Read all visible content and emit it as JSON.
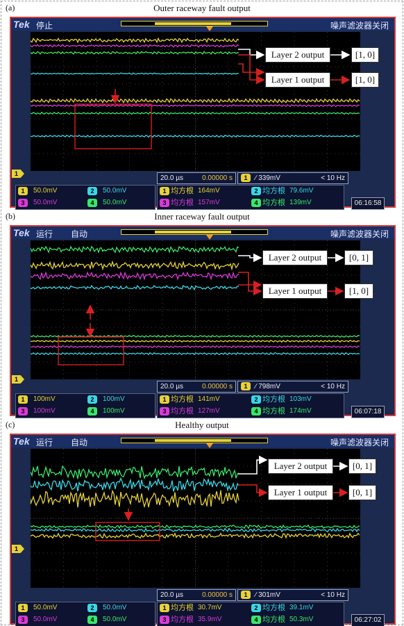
{
  "panels": [
    {
      "letter": "(a)",
      "title": "Outer raceway fault output",
      "scope": {
        "brand": "Tek",
        "run_state": "停止",
        "run_mode": "",
        "noise_filter": "噪声滤波器关闭",
        "timebase": "20.0 µs",
        "trigger_pos": "0.00000 s",
        "trigger_ch": "1",
        "trigger_level": "∕ 339mV",
        "trigger_freq": "< 10 Hz",
        "channels": [
          {
            "id": "1",
            "scale": "50.0mV",
            "color": "#e6d13a"
          },
          {
            "id": "2",
            "scale": "50.0mV",
            "color": "#3ad7e6"
          },
          {
            "id": "3",
            "scale": "50.0mV",
            "color": "#d83ad8"
          },
          {
            "id": "4",
            "scale": "50.0mV",
            "color": "#3ae66a"
          }
        ],
        "measurements": [
          {
            "id": "1",
            "label": "均方根",
            "value": "164mV",
            "color": "#e6d13a"
          },
          {
            "id": "2",
            "label": "均方根",
            "value": "79.6mV",
            "color": "#3ad7e6"
          },
          {
            "id": "3",
            "label": "均方根",
            "value": "157mV",
            "color": "#d83ad8"
          },
          {
            "id": "4",
            "label": "均方根",
            "value": "139mV",
            "color": "#3ae66a"
          }
        ],
        "clock": "06:16:58",
        "ground_marker": "1"
      },
      "annotations": {
        "layer2_label": "Layer 2 output",
        "layer2_result": "[1, 0]",
        "layer1_label": "Layer 1 output",
        "layer1_result": "[1, 0]"
      }
    },
    {
      "letter": "(b)",
      "title": "Inner raceway fault output",
      "scope": {
        "brand": "Tek",
        "run_state": "运行",
        "run_mode": "自动",
        "noise_filter": "噪声滤波器关闭",
        "timebase": "20.0 µs",
        "trigger_pos": "0.00000 s",
        "trigger_ch": "1",
        "trigger_level": "∕ 798mV",
        "trigger_freq": "< 10 Hz",
        "channels": [
          {
            "id": "1",
            "scale": "100mV",
            "color": "#e6d13a"
          },
          {
            "id": "2",
            "scale": "100mV",
            "color": "#3ad7e6"
          },
          {
            "id": "3",
            "scale": "100mV",
            "color": "#d83ad8"
          },
          {
            "id": "4",
            "scale": "100mV",
            "color": "#3ae66a"
          }
        ],
        "measurements": [
          {
            "id": "1",
            "label": "均方根",
            "value": "141mV",
            "color": "#e6d13a"
          },
          {
            "id": "2",
            "label": "均方根",
            "value": "103mV",
            "color": "#3ad7e6"
          },
          {
            "id": "3",
            "label": "均方根",
            "value": "127mV",
            "color": "#d83ad8"
          },
          {
            "id": "4",
            "label": "均方根",
            "value": "174mV",
            "color": "#3ae66a"
          }
        ],
        "clock": "06:07:18",
        "ground_marker": "1"
      },
      "annotations": {
        "layer2_label": "Layer 2 output",
        "layer2_result": "[0, 1]",
        "layer1_label": "Layer 1 output",
        "layer1_result": "[1, 0]"
      }
    },
    {
      "letter": "(c)",
      "title": "Healthy  output",
      "scope": {
        "brand": "Tek",
        "run_state": "运行",
        "run_mode": "自动",
        "noise_filter": "噪声滤波器关闭",
        "timebase": "20.0 µs",
        "trigger_pos": "0.00000 s",
        "trigger_ch": "1",
        "trigger_level": "∕ 301mV",
        "trigger_freq": "< 10 Hz",
        "channels": [
          {
            "id": "1",
            "scale": "50.0mV",
            "color": "#e6d13a"
          },
          {
            "id": "2",
            "scale": "50.0mV",
            "color": "#3ad7e6"
          },
          {
            "id": "3",
            "scale": "50.0mV",
            "color": "#d83ad8"
          },
          {
            "id": "4",
            "scale": "50.0mV",
            "color": "#3ae66a"
          }
        ],
        "measurements": [
          {
            "id": "1",
            "label": "均方根",
            "value": "30.7mV",
            "color": "#e6d13a"
          },
          {
            "id": "2",
            "label": "均方根",
            "value": "39.1mV",
            "color": "#3ad7e6"
          },
          {
            "id": "3",
            "label": "均方根",
            "value": "35.9mV",
            "color": "#d83ad8"
          },
          {
            "id": "4",
            "label": "均方根",
            "value": "50.3mV",
            "color": "#3ae66a"
          }
        ],
        "clock": "06:27:02",
        "ground_marker": "1"
      },
      "annotations": {
        "layer2_label": "Layer 2 output",
        "layer2_result": "[0, 1]",
        "layer1_label": "Layer 1 output",
        "layer1_result": "[0, 1]"
      }
    }
  ],
  "colors": {
    "arrow_red": "#d82020",
    "arrow_white": "#ffffff",
    "scope_frame": "#d83a3a",
    "scope_bezel": "#1a2f66",
    "trace_yellow": "#e6d13a",
    "trace_cyan": "#3ad7e6",
    "trace_magenta": "#d83ad8",
    "trace_green": "#3ae66a"
  }
}
